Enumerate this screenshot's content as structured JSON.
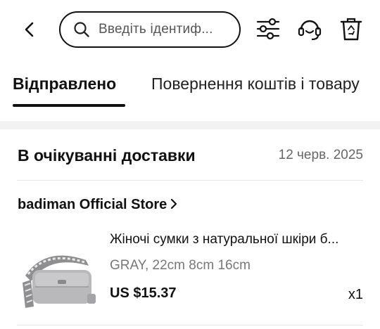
{
  "header": {
    "search_placeholder": "Введіть ідентиф..."
  },
  "icons": {
    "back": "chevron-left-icon",
    "search": "search-icon",
    "filter": "sliders-icon",
    "support": "headset-icon",
    "delete": "trash-icon"
  },
  "tabs": [
    {
      "label": "Відправлено",
      "active": true
    },
    {
      "label": "Повернення коштів і товару",
      "active": false
    }
  ],
  "order": {
    "status": "В очікуванні доставки",
    "date": "12 черв. 2025",
    "store": "badiman Official Store",
    "item": {
      "title": "Жіночі сумки з натуральної шкіри б...",
      "variant": "GRAY, 22cm 8cm 16cm",
      "price": "US $15.37",
      "quantity": "x1"
    }
  },
  "colors": {
    "text": "#111111",
    "muted": "#777777",
    "band": "#f2f2f2"
  }
}
